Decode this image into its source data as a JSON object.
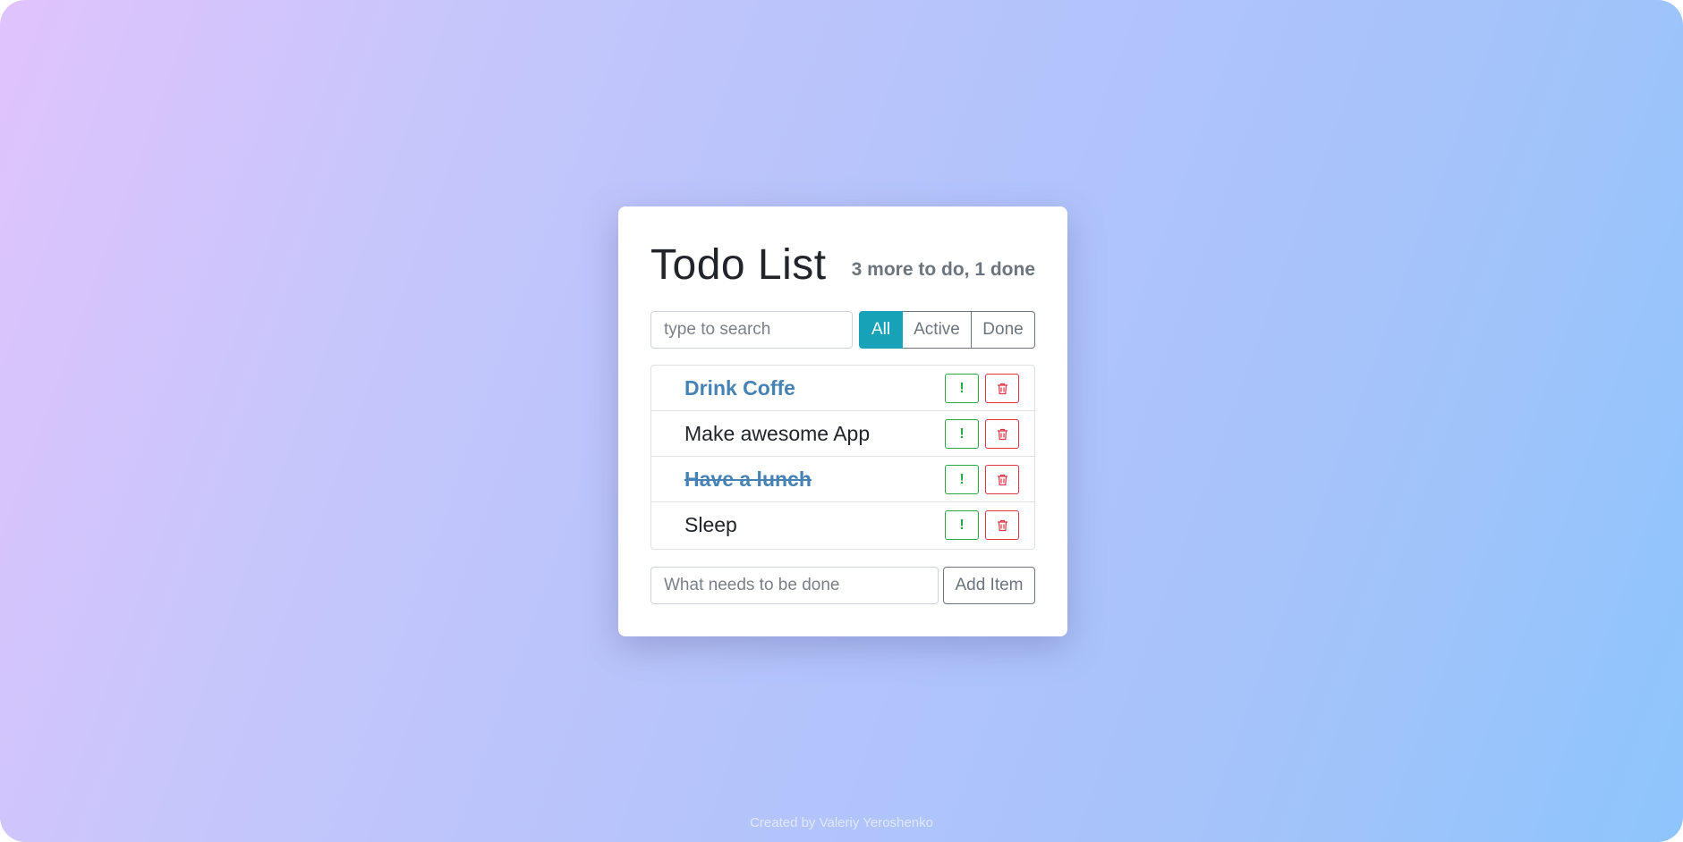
{
  "header": {
    "title": "Todo List",
    "counter": "3 more to do, 1 done"
  },
  "search": {
    "placeholder": "type to search",
    "value": ""
  },
  "filters": [
    {
      "label": "All",
      "active": true
    },
    {
      "label": "Active",
      "active": false
    },
    {
      "label": "Done",
      "active": false
    }
  ],
  "todos": [
    {
      "label": "Drink Coffe",
      "important": true,
      "done": false
    },
    {
      "label": "Make awesome App",
      "important": false,
      "done": false
    },
    {
      "label": "Have a lunch",
      "important": true,
      "done": true
    },
    {
      "label": "Sleep",
      "important": false,
      "done": false
    }
  ],
  "item_actions": {
    "important_icon": "exclamation-icon",
    "important_glyph": "!",
    "delete_icon": "trash-icon"
  },
  "add_form": {
    "placeholder": "What needs to be done",
    "value": "",
    "button_label": "Add Item"
  },
  "footer": {
    "text": "Created by Valeriy Yeroshenko"
  },
  "colors": {
    "accent": "#17a2b8",
    "important_text": "#4682b4",
    "success": "#28a745",
    "danger": "#dc3545",
    "muted": "#6c757d"
  }
}
